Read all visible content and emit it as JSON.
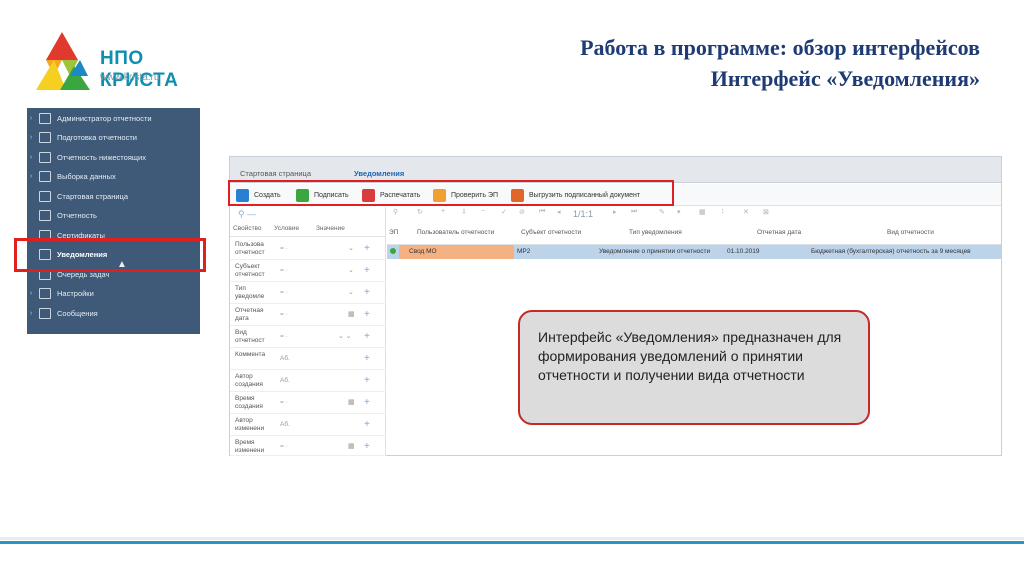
{
  "logo": {
    "name": "НПО КРИСТА",
    "site": "www.krista.ru",
    "colors": [
      "#e03a2e",
      "#f5a623",
      "#3aa640",
      "#9ec53a",
      "#1e88c7"
    ]
  },
  "titles": {
    "line1": "Работа в программе: обзор интерфейсов",
    "line2": "Интерфейс «Уведомления»"
  },
  "sidebar": {
    "items": [
      {
        "label": "Администратор отчетности",
        "icon": "admin-icon"
      },
      {
        "label": "Подготовка отчетности",
        "icon": "prepare-icon"
      },
      {
        "label": "Отчетность нижестоящих",
        "icon": "subordinate-icon"
      },
      {
        "label": "Выборка данных",
        "icon": "data-select-icon"
      },
      {
        "label": "Стартовая страница",
        "icon": "home-icon"
      },
      {
        "label": "Отчетность",
        "icon": "report-icon"
      },
      {
        "label": "Сертификаты",
        "icon": "certificate-icon"
      },
      {
        "label": "Уведомления",
        "icon": "notification-icon"
      },
      {
        "label": "Очередь задач",
        "icon": "queue-icon"
      },
      {
        "label": "Настройки",
        "icon": "settings-icon"
      },
      {
        "label": "Сообщения",
        "icon": "message-icon"
      }
    ],
    "active": "Уведомления"
  },
  "app": {
    "tabs": [
      "Стартовая страница",
      "Уведомления"
    ],
    "toolbar": [
      {
        "label": "Создать",
        "icon": "bell-icon",
        "color": "#2a7fd4"
      },
      {
        "label": "Подписать",
        "icon": "pen-icon",
        "color": "#3aa640"
      },
      {
        "label": "Распечатать",
        "icon": "print-icon",
        "color": "#d83b3b"
      },
      {
        "label": "Проверить ЭП",
        "icon": "check-signature-icon",
        "color": "#f0a030"
      },
      {
        "label": "Выгрузить подписанный документ",
        "icon": "export-icon",
        "color": "#e0662a"
      }
    ],
    "filter": {
      "headers": [
        "Свойство",
        "Условие",
        "Значение"
      ],
      "rows": [
        {
          "prop": "Пользова отчетност",
          "cond": "= ·",
          "ctrl": "⌄"
        },
        {
          "prop": "Субъект отчетност",
          "cond": "= ·",
          "ctrl": "⌄"
        },
        {
          "prop": "Тип уведомле",
          "cond": "= ·",
          "ctrl": "⌄"
        },
        {
          "prop": "Отчетная дата",
          "cond": "= ·",
          "ctrl": "▦"
        },
        {
          "prop": "Вид отчетност",
          "cond": "= ·",
          "ctrl": "⌄ ⌄"
        },
        {
          "prop": "Коммента",
          "cond": "Аб.",
          "ctrl": ""
        },
        {
          "prop": "Автор создания",
          "cond": "Аб.",
          "ctrl": ""
        },
        {
          "prop": "Время создания",
          "cond": "= ·",
          "ctrl": "▦"
        },
        {
          "prop": "Автор изменени",
          "cond": "Аб.",
          "ctrl": ""
        },
        {
          "prop": "Время изменени",
          "cond": "= ·",
          "ctrl": "▦"
        }
      ]
    },
    "grid": {
      "pager": "1/1:1",
      "columns": [
        "ЭП",
        "Пользователь отчетности",
        "Субъект отчетности",
        "Тип уведомления",
        "Отчетная дата",
        "Вид отчетности"
      ],
      "rows": [
        {
          "user": "Свод МО",
          "subject": "МР2",
          "type": "Уведомление о принятии отчетности",
          "date": "01.10.2019",
          "kind": "Бюджетная (бухгалтерская) отчетность за 9 месяцев"
        }
      ]
    }
  },
  "callout": {
    "text": "Интерфейс «Уведомления» предназначен для формирования уведомлений о принятии отчетности и получении вида отчетности"
  }
}
